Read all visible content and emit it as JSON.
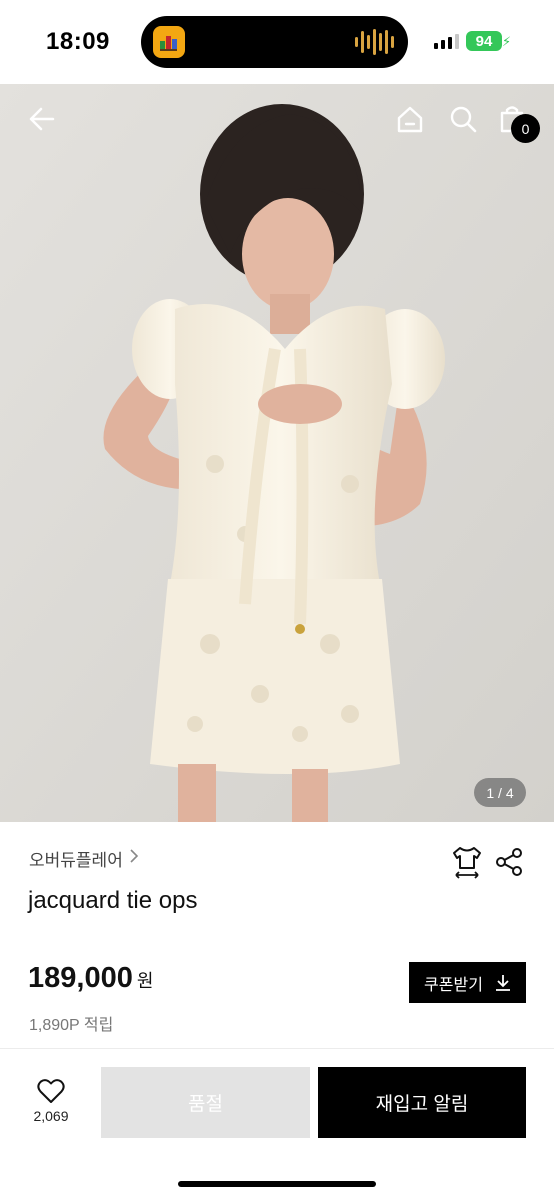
{
  "status_bar": {
    "time": "18:09",
    "battery": "94"
  },
  "hero": {
    "page_indicator": "1 / 4",
    "cart_count": "0",
    "icons": {
      "back": "arrow-left-icon",
      "home": "home-icon",
      "search": "search-icon",
      "cart": "shopping-bag-icon"
    }
  },
  "product": {
    "brand": "오버듀플레어",
    "name": "jacquard tie ops",
    "price": "189,000",
    "price_unit": "원",
    "points": "1,890P 적립",
    "coupon_label": "쿠폰받기"
  },
  "bottom_bar": {
    "like_count": "2,069",
    "soldout_label": "품절",
    "restock_label": "재입고 알림"
  },
  "colors": {
    "primary": "#000000",
    "disabled": "#e3e3e3",
    "battery": "#34c759"
  }
}
